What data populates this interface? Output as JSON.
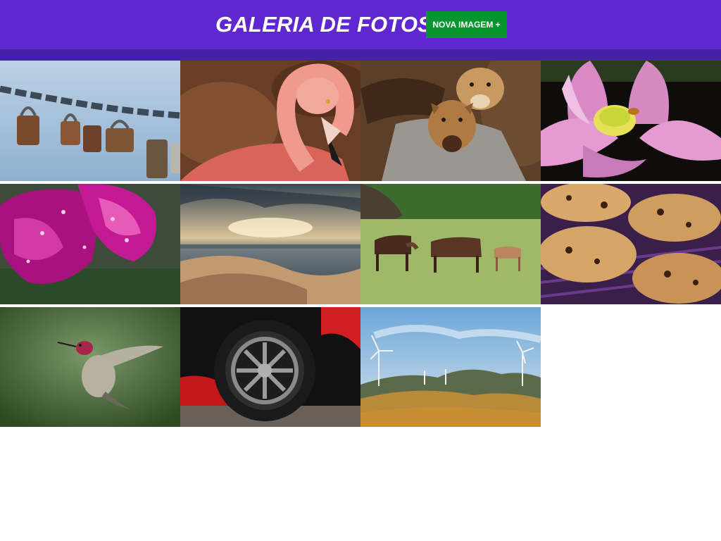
{
  "header": {
    "title": "GALERIA DE FOTOS",
    "new_image_button": "NOVA IMAGEM +",
    "colors": {
      "header_bg": "#5e27cf",
      "header_strip": "#4421a8",
      "button_bg": "#06962f",
      "text": "#ffffff"
    }
  },
  "gallery": {
    "columns": 4,
    "photos": [
      {
        "subject": "padlocks-on-chain",
        "icon": "padlock-photo"
      },
      {
        "subject": "pink-flamingo",
        "icon": "flamingo-photo"
      },
      {
        "subject": "puppies-in-blanket",
        "icon": "puppies-photo"
      },
      {
        "subject": "pink-lotus-flower-with-bee",
        "icon": "lotus-photo"
      },
      {
        "subject": "magenta-flower-with-raindrops",
        "icon": "flower-photo"
      },
      {
        "subject": "desert-dunes-at-sunset",
        "icon": "desert-photo"
      },
      {
        "subject": "horses-in-meadow",
        "icon": "horses-photo"
      },
      {
        "subject": "chocolate-chip-cookies",
        "icon": "cookies-photo"
      },
      {
        "subject": "hummingbird-in-flight",
        "icon": "hummingbird-photo"
      },
      {
        "subject": "car-wheel",
        "icon": "wheel-photo"
      },
      {
        "subject": "wind-turbines-on-hills",
        "icon": "turbines-photo"
      }
    ]
  }
}
